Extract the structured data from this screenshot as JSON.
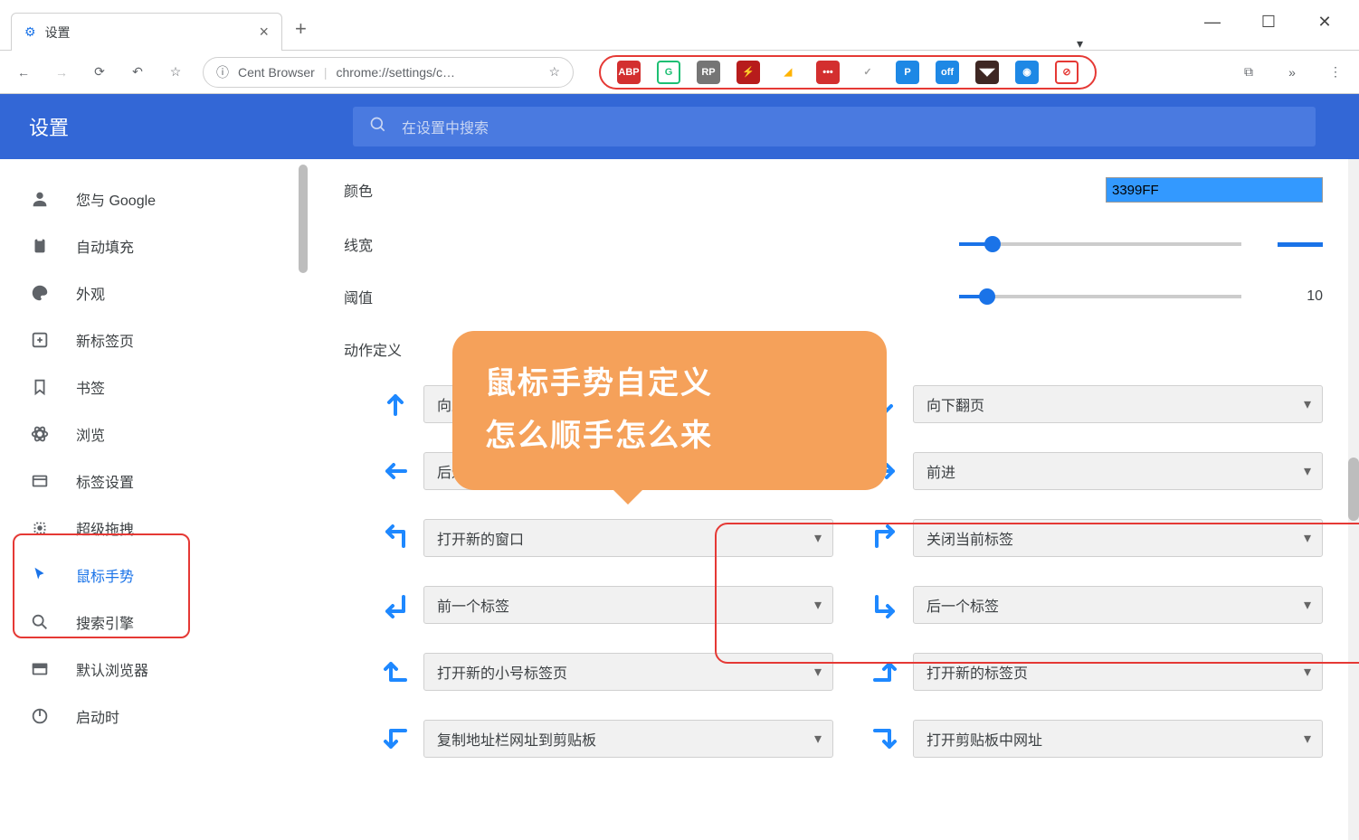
{
  "window": {
    "tab_title": "设置"
  },
  "toolbar": {
    "omnibox_prefix": "Cent Browser",
    "omnibox_url": "chrome://settings/c…",
    "extensions": [
      {
        "name": "abp",
        "bg": "#d32f2f",
        "txt": "ABP"
      },
      {
        "name": "grammarly",
        "bg": "#fff",
        "txt": "G",
        "fg": "#1dbf73",
        "border": "#1dbf73"
      },
      {
        "name": "axure",
        "bg": "#757575",
        "txt": "RP"
      },
      {
        "name": "flash",
        "bg": "#b71c1c",
        "txt": "⚡"
      },
      {
        "name": "colorpick",
        "bg": "#fff",
        "txt": "◢",
        "fg": "#ffb300"
      },
      {
        "name": "lastpass",
        "bg": "#d32f2f",
        "txt": "•••"
      },
      {
        "name": "check",
        "bg": "transparent",
        "txt": "✓",
        "fg": "#9e9e9e"
      },
      {
        "name": "park",
        "bg": "#1e88e5",
        "txt": "P"
      },
      {
        "name": "switch",
        "bg": "#1e88e5",
        "txt": "off"
      },
      {
        "name": "incognito",
        "bg": "#3e2723",
        "txt": "◥◤"
      },
      {
        "name": "compass",
        "bg": "#1e88e5",
        "txt": "◉"
      },
      {
        "name": "block",
        "bg": "#fff",
        "txt": "⊘",
        "fg": "#e53935",
        "border": "#e53935"
      }
    ]
  },
  "header": {
    "title": "设置",
    "search_placeholder": "在设置中搜索"
  },
  "sidebar": {
    "items": [
      {
        "icon": "person",
        "label": "您与 Google"
      },
      {
        "icon": "clipboard",
        "label": "自动填充"
      },
      {
        "icon": "palette",
        "label": "外观"
      },
      {
        "icon": "plus-box",
        "label": "新标签页"
      },
      {
        "icon": "bookmark",
        "label": "书签"
      },
      {
        "icon": "atom",
        "label": "浏览"
      },
      {
        "icon": "tab",
        "label": "标签设置"
      },
      {
        "icon": "drag",
        "label": "超级拖拽"
      },
      {
        "icon": "cursor",
        "label": "鼠标手势",
        "active": true
      },
      {
        "icon": "search",
        "label": "搜索引擎"
      },
      {
        "icon": "browser",
        "label": "默认浏览器"
      },
      {
        "icon": "power",
        "label": "启动时"
      }
    ]
  },
  "settings": {
    "color_label": "颜色",
    "color_value": "3399FF",
    "linewidth_label": "线宽",
    "threshold_label": "阈值",
    "threshold_value": "10",
    "actions_label": "动作定义",
    "gestures": [
      {
        "dir": "up",
        "action": "向上翻页"
      },
      {
        "dir": "down",
        "action": "向下翻页"
      },
      {
        "dir": "left",
        "action": "后退"
      },
      {
        "dir": "right",
        "action": "前进"
      },
      {
        "dir": "up-left",
        "action": "打开新的窗口"
      },
      {
        "dir": "up-right",
        "action": "关闭当前标签"
      },
      {
        "dir": "down-left",
        "action": "前一个标签"
      },
      {
        "dir": "down-right",
        "action": "后一个标签"
      },
      {
        "dir": "left-up",
        "action": "打开新的小号标签页"
      },
      {
        "dir": "right-up",
        "action": "打开新的标签页"
      },
      {
        "dir": "left-down",
        "action": "复制地址栏网址到剪贴板"
      },
      {
        "dir": "right-down",
        "action": "打开剪贴板中网址"
      }
    ]
  },
  "bubble": {
    "line1": "鼠标手势自定义",
    "line2": "怎么顺手怎么来"
  }
}
